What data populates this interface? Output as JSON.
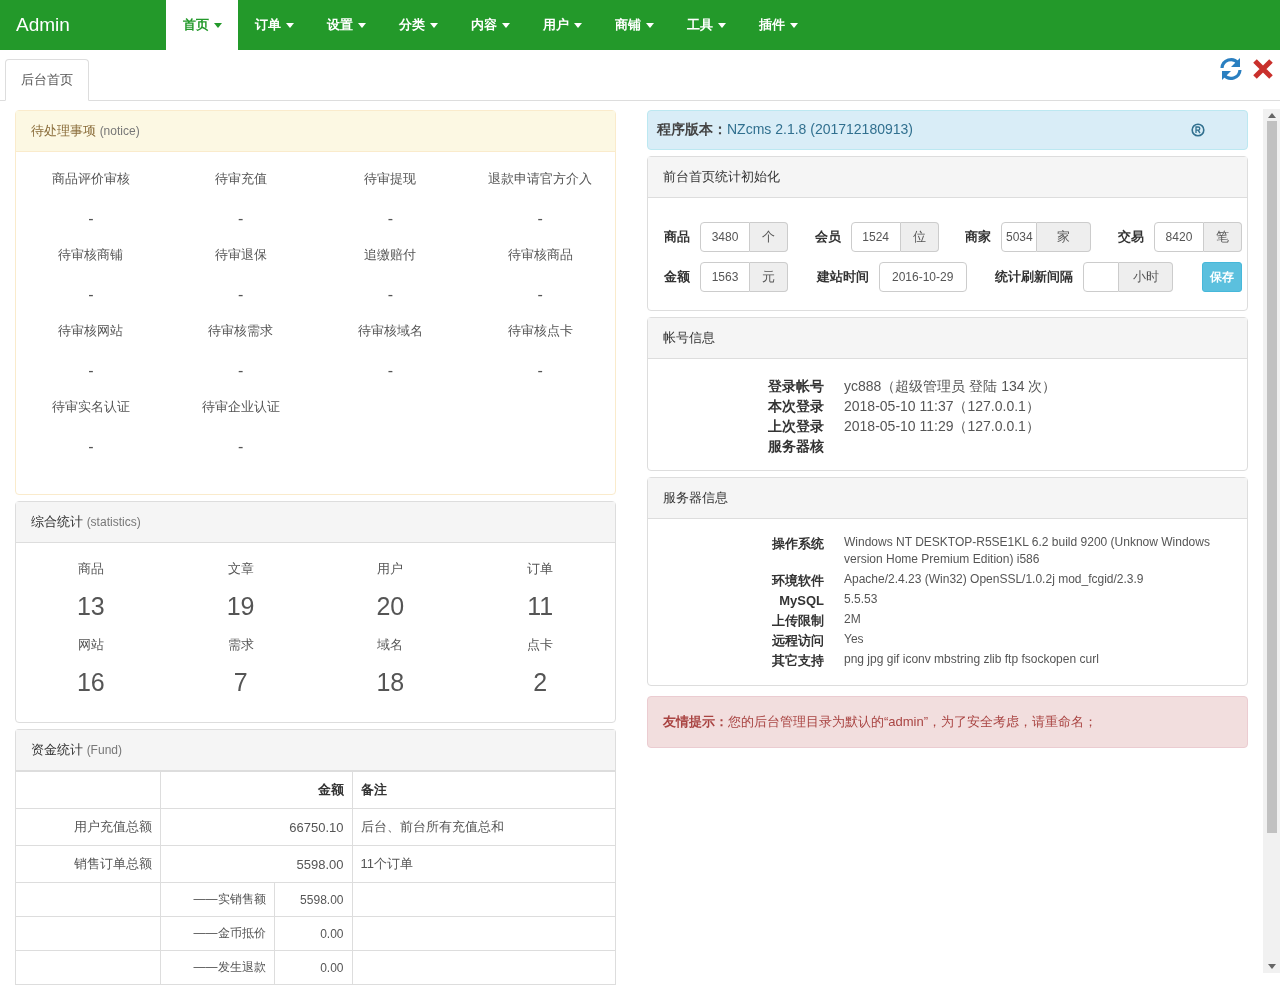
{
  "nav": {
    "brand": "Admin",
    "items": [
      {
        "label": "首页",
        "selected": true
      },
      {
        "label": "订单",
        "selected": false
      },
      {
        "label": "设置",
        "selected": false
      },
      {
        "label": "分类",
        "selected": false
      },
      {
        "label": "内容",
        "selected": false
      },
      {
        "label": "用户",
        "selected": false
      },
      {
        "label": "商铺",
        "selected": false
      },
      {
        "label": "工具",
        "selected": false
      },
      {
        "label": "插件",
        "selected": false
      }
    ]
  },
  "tabs": [
    {
      "label": "后台首页",
      "selected": true
    }
  ],
  "notice": {
    "title": "待处理事项",
    "subtitle": "(notice)",
    "items": [
      {
        "label": "商品评价审核",
        "value": "-"
      },
      {
        "label": "待审充值",
        "value": "-"
      },
      {
        "label": "待审提现",
        "value": "-"
      },
      {
        "label": "退款申请官方介入",
        "value": "-"
      },
      {
        "label": "待审核商铺",
        "value": "-"
      },
      {
        "label": "待审退保",
        "value": "-"
      },
      {
        "label": "追缴赔付",
        "value": "-"
      },
      {
        "label": "待审核商品",
        "value": "-"
      },
      {
        "label": "待审核网站",
        "value": "-"
      },
      {
        "label": "待审核需求",
        "value": "-"
      },
      {
        "label": "待审核域名",
        "value": "-"
      },
      {
        "label": "待审核点卡",
        "value": "-"
      },
      {
        "label": "待审实名认证",
        "value": "-"
      },
      {
        "label": "待审企业认证",
        "value": "-"
      }
    ]
  },
  "statistics": {
    "title": "综合统计",
    "subtitle": "(statistics)",
    "items": [
      {
        "label": "商品",
        "value": "13"
      },
      {
        "label": "文章",
        "value": "19"
      },
      {
        "label": "用户",
        "value": "20"
      },
      {
        "label": "订单",
        "value": "11"
      },
      {
        "label": "网站",
        "value": "16"
      },
      {
        "label": "需求",
        "value": "7"
      },
      {
        "label": "域名",
        "value": "18"
      },
      {
        "label": "点卡",
        "value": "2"
      }
    ]
  },
  "fund": {
    "title": "资金统计",
    "subtitle": "(Fund)",
    "columns": [
      "金额",
      "备注"
    ],
    "rows": [
      {
        "kind": "main",
        "label": "用户充值总额",
        "amount": "66750.10",
        "note": "后台、前台所有充值总和"
      },
      {
        "kind": "main",
        "label": "销售订单总额",
        "amount": "5598.00",
        "note": "11个订单"
      },
      {
        "kind": "sub",
        "label": "——实销售额",
        "amount": "5598.00"
      },
      {
        "kind": "sub",
        "label": "——金币抵价",
        "amount": "0.00"
      },
      {
        "kind": "sub",
        "label": "——发生退款",
        "amount": "0.00"
      }
    ]
  },
  "version": {
    "label": "程序版本：",
    "value": "NZcms 2.1.8 (201712180913)"
  },
  "init": {
    "title": "前台首页统计初始化",
    "rows": [
      [
        {
          "label": "商品",
          "value": "3480",
          "unit": "个"
        },
        {
          "label": "会员",
          "value": "1524",
          "unit": "位"
        },
        {
          "label": "商家",
          "value": "5034",
          "unit": "家"
        },
        {
          "label": "交易",
          "value": "8420",
          "unit": "笔"
        }
      ],
      [
        {
          "label": "金额",
          "value": "1563",
          "unit": "元"
        },
        {
          "label": "建站时间",
          "value": "2016-10-29"
        },
        {
          "label": "统计刷新间隔",
          "unit": "小时"
        }
      ]
    ],
    "button": "保存"
  },
  "account": {
    "title": "帐号信息",
    "rows": [
      {
        "label": "登录帐号",
        "value": "yc888（超级管理员 登陆 134 次）"
      },
      {
        "label": "本次登录",
        "value": "2018-05-10 11:37（127.0.0.1）"
      },
      {
        "label": "上次登录",
        "value": "2018-05-10 11:29（127.0.0.1）"
      },
      {
        "label": "服务器核"
      }
    ]
  },
  "server": {
    "title": "服务器信息",
    "rows": [
      {
        "label": "操作系统",
        "value": "Windows NT DESKTOP-R5SE1KL 6.2 build 9200 (Unknow Windows version Home Premium Edition) i586"
      },
      {
        "label": "环境软件",
        "value": "Apache/2.4.23 (Win32) OpenSSL/1.0.2j mod_fcgid/2.3.9"
      },
      {
        "label": "MySQL",
        "value": "5.5.53"
      },
      {
        "label": "上传限制",
        "value": "2M"
      },
      {
        "label": "远程访问",
        "value": "Yes"
      },
      {
        "label": "其它支持",
        "value": "png jpg gif iconv mbstring zlib ftp fsockopen curl"
      }
    ]
  },
  "alert": {
    "label": "友情提示：",
    "text": "您的后台管理目录为默认的“admin”，为了安全考虑，请重命名；"
  }
}
